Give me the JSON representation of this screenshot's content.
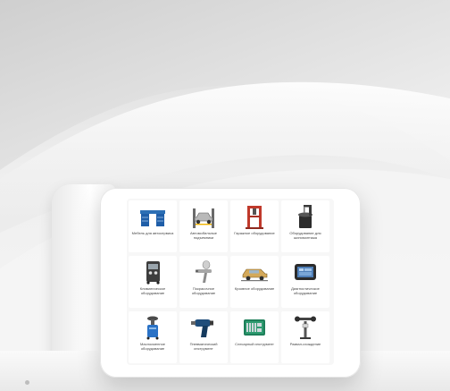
{
  "catalog": {
    "items": [
      {
        "label": "Мебель для автосервиса",
        "icon": "workbench-icon"
      },
      {
        "label": "Автомобильные подъемники",
        "icon": "car-lift-icon"
      },
      {
        "label": "Гаражное оборудование",
        "icon": "hydraulic-press-icon"
      },
      {
        "label": "Оборудование для шиномонтажа",
        "icon": "tire-changer-icon"
      },
      {
        "label": "Климатическое оборудование",
        "icon": "ac-station-icon"
      },
      {
        "label": "Покрасочное оборудование",
        "icon": "spray-gun-icon"
      },
      {
        "label": "Кузовное оборудование",
        "icon": "body-repair-car-icon"
      },
      {
        "label": "Диагностическое оборудование",
        "icon": "diagnostic-scanner-icon"
      },
      {
        "label": "Маслосменное оборудование",
        "icon": "oil-changer-icon"
      },
      {
        "label": "Пневматический инструмент",
        "icon": "impact-wrench-icon"
      },
      {
        "label": "Слесарный инструмент",
        "icon": "tool-kit-icon"
      },
      {
        "label": "Развал-схождение",
        "icon": "wheel-alignment-icon"
      }
    ]
  }
}
